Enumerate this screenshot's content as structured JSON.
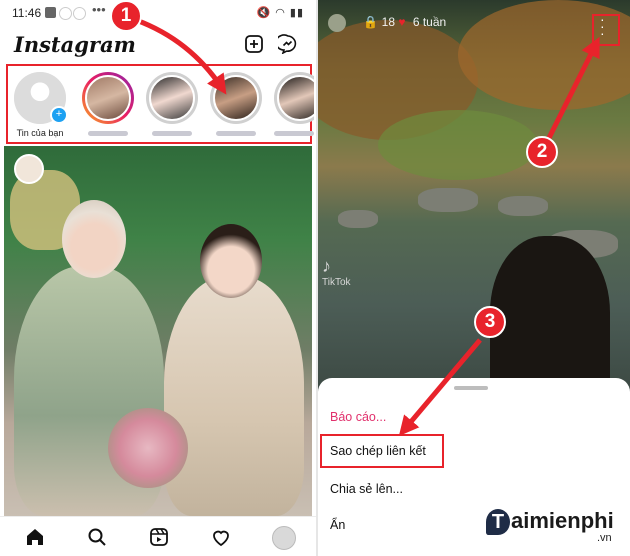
{
  "left": {
    "status": {
      "time": "11:46"
    },
    "header": {
      "logo": "Instagram"
    },
    "stories": [
      {
        "caption": "Tin của bạn"
      }
    ],
    "nav_icons": [
      "home-icon",
      "search-icon",
      "reels-icon",
      "heart-icon",
      "profile-icon"
    ]
  },
  "right": {
    "status": {
      "likes": "18",
      "time_ago": "6 tuần"
    },
    "watermark": "TikTok",
    "sheet": {
      "options": [
        {
          "label": "Báo cáo...",
          "color": "#e1306c"
        },
        {
          "label": "Sao chép liên kết"
        },
        {
          "label": "Chia sẻ lên..."
        },
        {
          "label": "Ẩn"
        }
      ]
    },
    "brand": {
      "name": "aimienphi",
      "suffix": ".vn"
    }
  },
  "annotations": {
    "markers": [
      "1",
      "2",
      "3"
    ]
  },
  "colors": {
    "accent": "#e8232b",
    "link_red": "#e1306c"
  }
}
